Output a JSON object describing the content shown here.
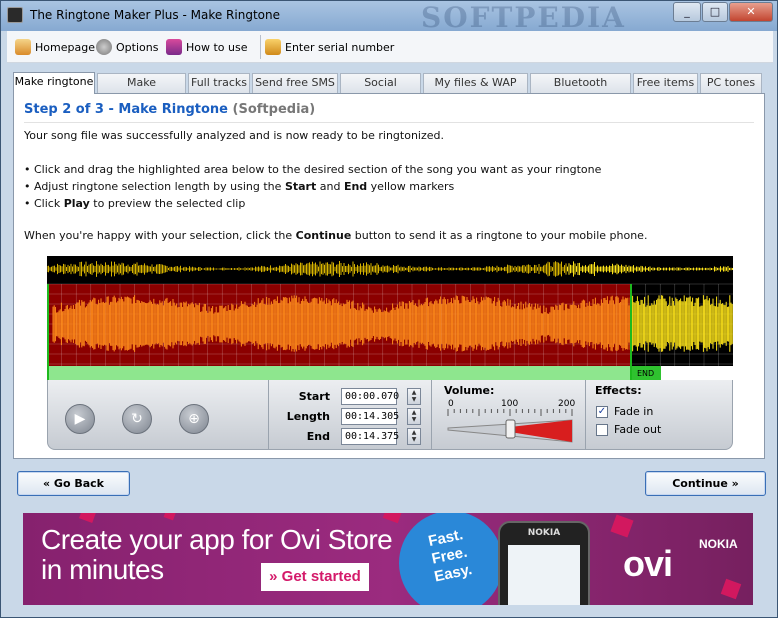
{
  "window": {
    "title": "The Ringtone Maker Plus - Make Ringtone",
    "watermark": "SOFTPEDIA",
    "buttons": {
      "minimize": "_",
      "maximize": "□",
      "close": "✕"
    }
  },
  "menubar": {
    "items": [
      {
        "label": "Homepage",
        "icon": "home-icon"
      },
      {
        "label": "Options",
        "icon": "gear-icon"
      },
      {
        "label": "How to use",
        "icon": "book-icon"
      },
      {
        "label": "Enter serial number",
        "icon": "key-icon"
      }
    ]
  },
  "tabs": [
    {
      "label": "Make ringtone",
      "active": true
    },
    {
      "label": "Make wallpapers"
    },
    {
      "label": "Full tracks"
    },
    {
      "label": "Send free SMS"
    },
    {
      "label": "Social network"
    },
    {
      "label": "My files & WAP site"
    },
    {
      "label": "Bluetooth uploader"
    },
    {
      "label": "Free items"
    },
    {
      "label": "PC tones"
    }
  ],
  "main": {
    "step_title": "Step 2 of 3 - Make Ringtone",
    "step_suffix": "(Softpedia)",
    "intro": "Your song file was successfully analyzed and is now ready to be ringtonized.",
    "bullet1": "• Click and drag the highlighted area below to the desired section of the song you want as your ringtone",
    "bullet2_pre": "• Adjust ringtone selection length by using the ",
    "bullet2_start": "Start",
    "bullet2_mid": " and ",
    "bullet2_end": "End",
    "bullet2_post": " yellow markers",
    "bullet3_pre": "• Click ",
    "bullet3_play": "Play",
    "bullet3_post": " to preview the selected clip",
    "final_pre": "When you're happy with your selection, click the ",
    "final_continue": "Continue",
    "final_post": " button to send it as a ringtone to your mobile phone."
  },
  "waveform": {
    "end_marker": "END",
    "colors": {
      "background": "#000000",
      "selection": "#8b0000",
      "wave": "#ff8c1a",
      "wave_tail": "#ffe61a",
      "bar": "#8ee68e"
    }
  },
  "controls": {
    "start_label": "Start",
    "start_value": "00:00.070",
    "length_label": "Length",
    "length_value": "00:14.305",
    "end_label": "End",
    "end_value": "00:14.375",
    "volume_label": "Volume:",
    "volume_ticks": [
      "0",
      "100",
      "200"
    ],
    "volume_level": 100,
    "effects_label": "Effects:",
    "fade_in_label": "Fade in",
    "fade_in_checked": true,
    "fade_out_label": "Fade out",
    "fade_out_checked": false
  },
  "nav": {
    "back_label": "« Go Back",
    "continue_label": "Continue »"
  },
  "banner": {
    "headline_line1": "Create your app for Ovi Store",
    "headline_line2": "in minutes",
    "cta": "» Get started",
    "burst_line1": "Fast.",
    "burst_line2": "Free.",
    "burst_line3": "Easy.",
    "phone_brand": "NOKIA",
    "ovi_text": "ovi",
    "nokia_text": "NOKIA"
  }
}
